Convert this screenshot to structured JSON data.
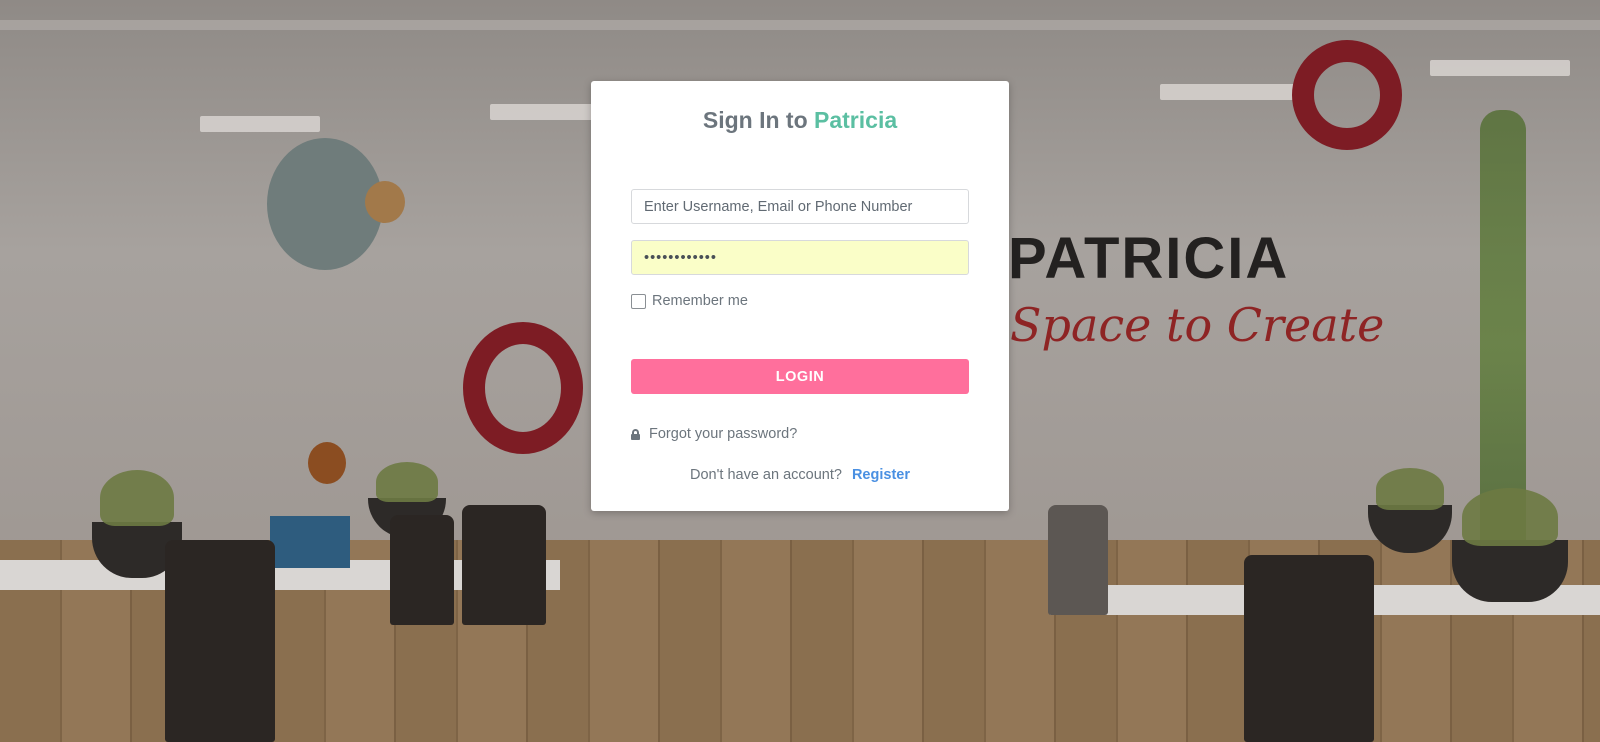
{
  "login": {
    "title_prefix": "Sign In to",
    "title_brand": "Patricia",
    "username_placeholder": "Enter Username, Email or Phone Number",
    "username_value": "",
    "password_value": "••••••••••••",
    "remember_label": "Remember me",
    "remember_checked": false,
    "login_button": "LOGIN",
    "forgot_password": "Forgot your password?",
    "no_account_text": "Don't have an account?",
    "register_link": "Register"
  },
  "background": {
    "wall_brand": "PATRICIA",
    "wall_tagline": "Space to Create"
  },
  "colors": {
    "brand": "#5bbfa2",
    "login_button": "#ff6f9c",
    "link": "#4a90e2",
    "autofill": "#fafec8"
  },
  "icons": {
    "lock": "lock-icon"
  }
}
